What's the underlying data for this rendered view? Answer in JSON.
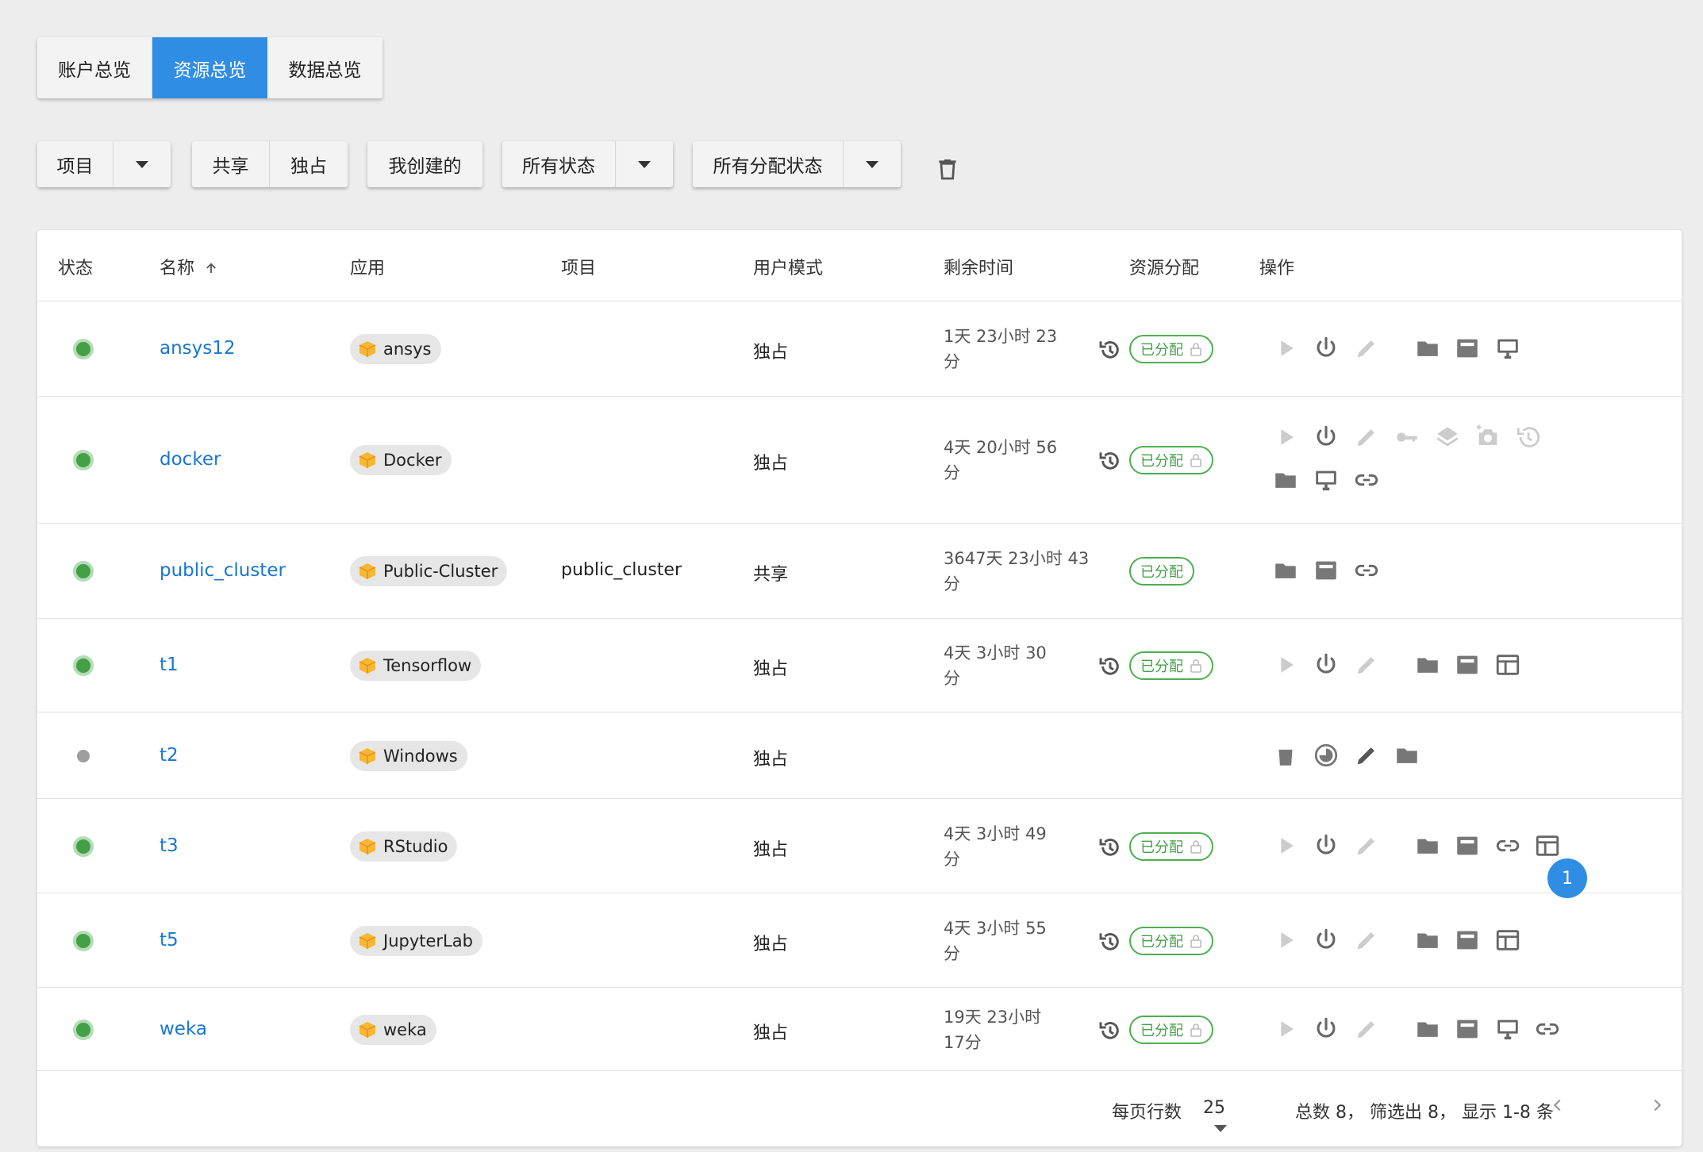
{
  "tabs": [
    "账户总览",
    "资源总览",
    "数据总览"
  ],
  "active_tab": "资源总览",
  "filters": {
    "project": "项目",
    "shared": "共享",
    "exclusive": "独占",
    "mine": "我创建的",
    "all_status": "所有状态",
    "all_alloc_status": "所有分配状态"
  },
  "colors": {
    "accent": "#2f8de4",
    "link": "#1976d2",
    "running": "#43a047",
    "badge": "#4caf50"
  },
  "table": {
    "columns": [
      "状态",
      "名称",
      "应用",
      "项目",
      "用户模式",
      "剩余时间",
      "资源分配",
      "操作"
    ],
    "sort_icon": "arrow-up-icon",
    "rows": [
      {
        "status": "running",
        "name": "ansys12",
        "app": "ansys",
        "project": "",
        "mode": "独占",
        "remain1": "1天 23小时 23",
        "remain2": "分",
        "alloc": "已分配",
        "locked": true,
        "renew": true,
        "actions": [
          [
            "play-icon",
            "power-icon",
            "edit-icon",
            "folder-icon",
            "terminal-icon",
            "desktop-icon"
          ]
        ]
      },
      {
        "status": "running",
        "name": "docker",
        "app": "Docker",
        "project": "",
        "mode": "独占",
        "remain1": "4天 20小时 56",
        "remain2": "分",
        "alloc": "已分配",
        "locked": true,
        "renew": true,
        "actions": [
          [
            "play-icon",
            "power-icon",
            "edit-icon",
            "key-icon",
            "layers-icon",
            "snapshot-icon",
            "restore-icon"
          ],
          [
            "folder-icon",
            "desktop-icon",
            "link-icon"
          ]
        ]
      },
      {
        "status": "running",
        "name": "public_cluster",
        "app": "Public-Cluster",
        "project": "public_cluster",
        "mode": "共享",
        "remain1": "3647天 23小时 43",
        "remain2": "分",
        "alloc": "已分配",
        "locked": false,
        "renew": false,
        "actions": [
          [
            "folder-icon",
            "terminal-icon",
            "link-icon"
          ]
        ]
      },
      {
        "status": "running",
        "name": "t1",
        "app": "Tensorflow",
        "project": "",
        "mode": "独占",
        "remain1": "4天 3小时 30",
        "remain2": "分",
        "alloc": "已分配",
        "locked": true,
        "renew": true,
        "actions": [
          [
            "play-icon",
            "power-icon",
            "edit-icon",
            "folder-icon",
            "terminal-icon",
            "web-icon"
          ]
        ]
      },
      {
        "status": "stopped",
        "name": "t2",
        "app": "Windows",
        "project": "",
        "mode": "独占",
        "remain1": "",
        "remain2": "",
        "alloc": "",
        "locked": false,
        "renew": false,
        "actions": [
          [
            "delete-icon",
            "pie-icon",
            "edit-icon",
            "folder-icon"
          ]
        ]
      },
      {
        "status": "running",
        "name": "t3",
        "app": "RStudio",
        "project": "",
        "mode": "独占",
        "remain1": "4天 3小时 49",
        "remain2": "分",
        "alloc": "已分配",
        "locked": true,
        "renew": true,
        "actions": [
          [
            "play-icon",
            "power-icon",
            "edit-icon",
            "folder-icon",
            "terminal-icon",
            "link-icon",
            "web-icon"
          ]
        ]
      },
      {
        "status": "running",
        "name": "t5",
        "app": "JupyterLab",
        "project": "",
        "mode": "独占",
        "remain1": "4天 3小时 55",
        "remain2": "分",
        "alloc": "已分配",
        "locked": true,
        "renew": true,
        "actions": [
          [
            "play-icon",
            "power-icon",
            "edit-icon",
            "folder-icon",
            "terminal-icon",
            "web-icon"
          ]
        ]
      },
      {
        "status": "running",
        "name": "weka",
        "app": "weka",
        "project": "",
        "mode": "独占",
        "remain1": "19天 23小时",
        "remain2": "17分",
        "alloc": "已分配",
        "locked": true,
        "renew": true,
        "actions": [
          [
            "play-icon",
            "power-icon",
            "edit-icon",
            "folder-icon",
            "terminal-icon",
            "desktop-icon",
            "link-icon"
          ]
        ]
      }
    ]
  },
  "footer": {
    "rows_per_page_label": "每页行数",
    "rows_per_page_value": "25",
    "summary": "总数 8， 筛选出 8， 显示 1-8 条",
    "page": "1"
  }
}
